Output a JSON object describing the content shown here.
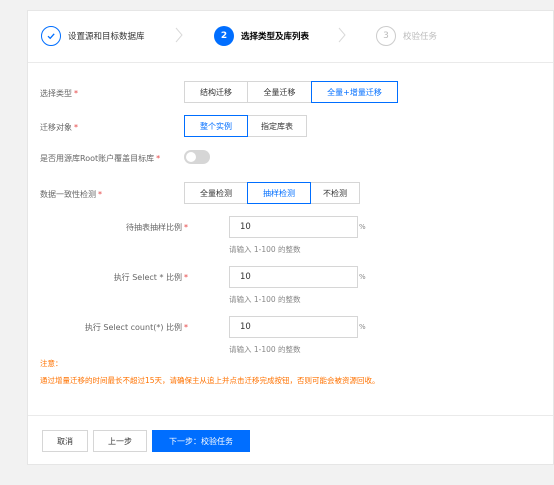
{
  "steps": [
    {
      "label": "设置源和目标数据库",
      "state": "done"
    },
    {
      "number": "2",
      "label": "选择类型及库列表",
      "state": "active"
    },
    {
      "number": "3",
      "label": "校验任务",
      "state": "todo"
    }
  ],
  "form": {
    "check_type": {
      "label": "选择类型",
      "required_mark": "*",
      "options": [
        "结构迁移",
        "全量迁移",
        "全量+增量迁移"
      ],
      "selected": "全量+增量迁移"
    },
    "migrate_object": {
      "label": "迁移对象",
      "required_mark": "*",
      "options": [
        "整个实例",
        "指定库表"
      ],
      "selected": "整个实例"
    },
    "root_account": {
      "label": "是否用源库Root账户覆盖目标库",
      "required_mark": "*",
      "enabled": false
    },
    "consistency_check": {
      "label": "数据一致性检测",
      "required_mark": "*",
      "options": [
        "全量检测",
        "抽样检测",
        "不检测"
      ],
      "selected": "抽样检测"
    },
    "sample_fields": [
      {
        "label": "待抽表抽样比例",
        "required_mark": "*",
        "value": "10",
        "unit": "%",
        "hint": "请输入 1-100 的整数"
      },
      {
        "label": "执行 Select * 比例",
        "required_mark": "*",
        "value": "10",
        "unit": "%",
        "hint": "请输入 1-100 的整数"
      },
      {
        "label": "执行 Select count(*) 比例",
        "required_mark": "*",
        "value": "10",
        "unit": "%",
        "hint": "请输入 1-100 的整数"
      }
    ]
  },
  "note": {
    "title": "注意：",
    "text": "通过增量迁移的时间最长不超过15天，请确保主从追上并点击迁移完成按钮，否则可能会被资源回收。"
  },
  "footer": {
    "cancel_label": "取消",
    "prev_label": "上一步",
    "next_label": "下一步：校验任务"
  },
  "colors": {
    "accent": "#006eff",
    "warning": "#ff7200",
    "required": "#e54545"
  }
}
